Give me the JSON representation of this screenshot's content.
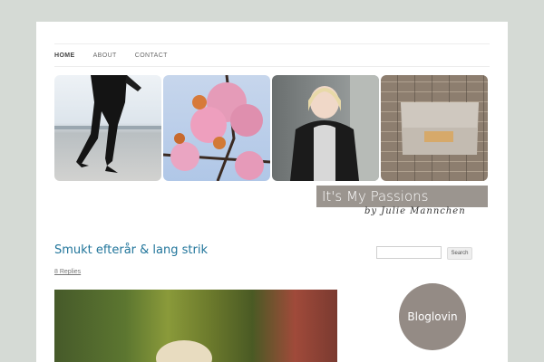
{
  "nav": {
    "items": [
      {
        "label": "HOME",
        "active": true
      },
      {
        "label": "ABOUT",
        "active": false
      },
      {
        "label": "CONTACT",
        "active": false
      }
    ]
  },
  "banner": {
    "logo_text": "It's My Passions",
    "logo_sub": "by Julie Mannchen"
  },
  "post": {
    "title": "Smukt efterår & lang strik",
    "replies": "8 Replies"
  },
  "sidebar": {
    "search_value": "",
    "search_button": "Search",
    "bloglovin": "Bloglovin"
  },
  "colors": {
    "link": "#21759b",
    "background": "#d5dad5",
    "logo_box": "#9b958f"
  }
}
